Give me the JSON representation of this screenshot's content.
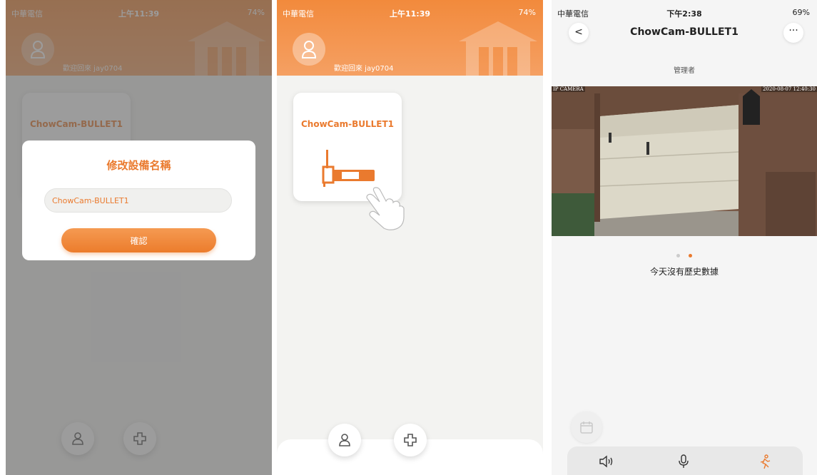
{
  "status_a": {
    "carrier": "中華電信",
    "time": "上午11:39",
    "battery": "74%"
  },
  "status_b": {
    "carrier": "中華電信",
    "time": "下午2:38",
    "battery": "69%"
  },
  "home": {
    "welcome": "歡迎回來 jay0704",
    "device_name": "ChowCam-BULLET1"
  },
  "rename_dialog": {
    "title": "修改設備名稱",
    "input_value": "ChowCam-BULLET1",
    "confirm_label": "確認"
  },
  "detail": {
    "title": "ChowCam-BULLET1",
    "back_glyph": "<",
    "more_glyph": "···",
    "role": "管理者",
    "osd_left": "IP CAMERA",
    "osd_right": "2020-08-07  12:40:30",
    "carousel": {
      "count": 2,
      "active": 2
    },
    "no_data": "今天沒有歷史數據"
  },
  "colors": {
    "accent": "#ea7a2e",
    "header": "#f28a3c"
  },
  "icons": [
    "user-icon",
    "add-device-icon",
    "camera-icon",
    "hand-pointer-icon",
    "calendar-icon",
    "speaker-icon",
    "microphone-icon",
    "motion-icon",
    "house-icon"
  ]
}
